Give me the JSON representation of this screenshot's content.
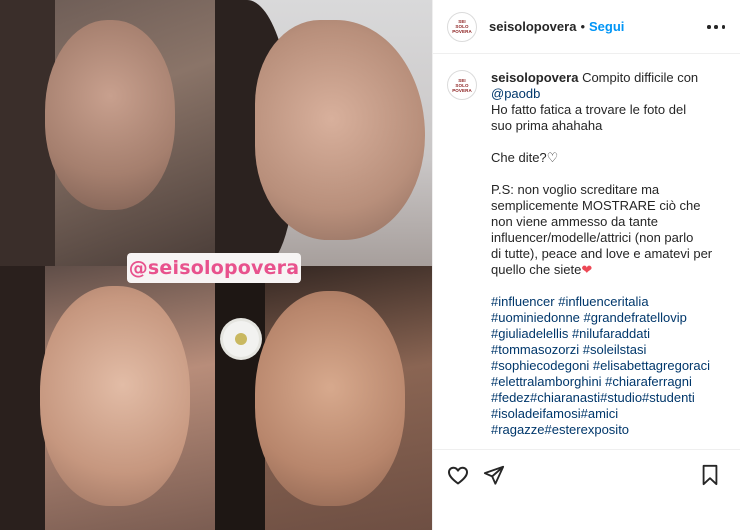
{
  "post": {
    "watermark": "@seisolopovera"
  },
  "header": {
    "username": "seisolopovera",
    "separator": "•",
    "follow_label": "Segui"
  },
  "avatar_lines": [
    "SEI",
    "SOLO",
    "POVERA"
  ],
  "caption": {
    "username": "seisolopovera",
    "intro": "Compito difficile con",
    "mention": "@paodb",
    "line1": "Ho fatto fatica a trovare le foto del",
    "line2": "suo prima ahahaha",
    "question": "Che dite?",
    "question_emoji": "♡",
    "ps1": "P.S: non voglio screditare ma",
    "ps2": "semplicemente MOSTRARE ciò che",
    "ps3": "non viene ammesso da tante",
    "ps4": "influencer/modelle/attrici (non parlo",
    "ps5": "di tutte), peace and love e amatevi per",
    "ps6": "quello che siete",
    "ps_emoji": "❤",
    "hashtag_lines": [
      "#influencer #influenceritalia",
      "#uominiedonne #grandefratellovip",
      "#giuliadelellis #nilufaraddati",
      "#tommasozorzi #soleilstasi",
      "#sophiecodegoni #elisabettagregoraci",
      "#elettralamborghini #chiaraferragni",
      "#fedez#chiaranasti#studio#studenti",
      "#isoladeifamosi#amici",
      "#ragazze#esterexposito"
    ]
  },
  "icons": {
    "like": "heart-icon",
    "share": "paper-plane-icon",
    "save": "bookmark-icon",
    "more": "more-options-icon"
  },
  "colors": {
    "link_blue": "#0095f6",
    "hashtag": "#00376b",
    "watermark_pink": "#e8528d"
  }
}
